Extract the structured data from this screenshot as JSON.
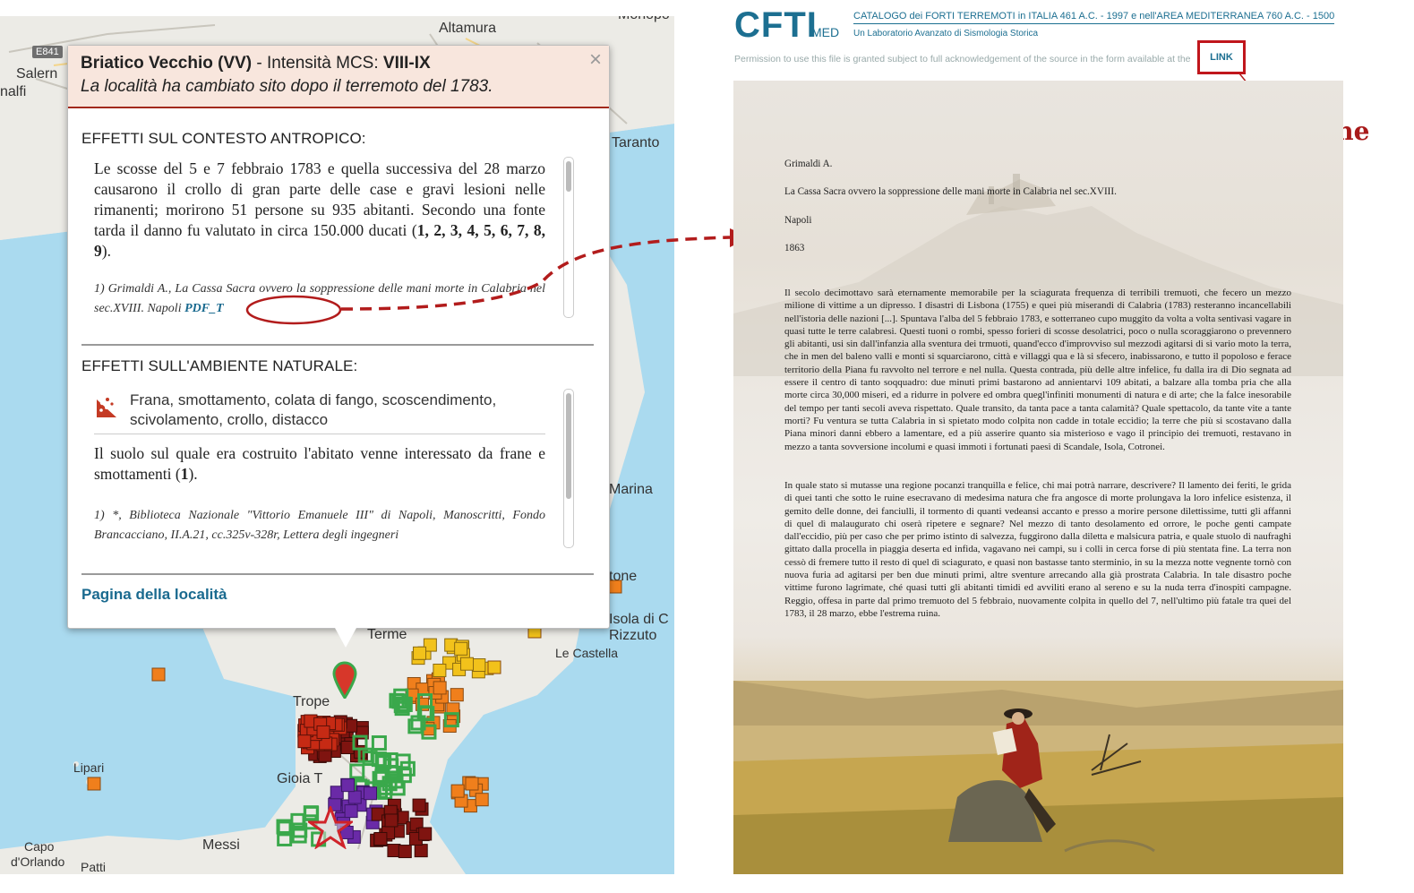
{
  "map": {
    "labels": {
      "altamura": "Altamura",
      "monopoli": "Monopo",
      "salerno": "Salern",
      "amalfi": "nalfi",
      "taranto": "Taranto",
      "marina": "Marina",
      "crotone": "tone",
      "isola1": "Isola di C",
      "isola2": "Rizzuto",
      "castella": "Le Castella",
      "terme": "Terme",
      "tropea": "Trope",
      "gioia": "Gioia T",
      "lipari": "Lipari",
      "capo1": "Capo",
      "capo2": "d'Orlando",
      "patti": "Patti",
      "messina": "Messi"
    },
    "road_badge": "E841",
    "colors": {
      "red": "#c62a14",
      "darkred": "#7f1410",
      "green": "#3aa84b",
      "orange": "#f07f1c",
      "yellow": "#f2c21b",
      "purple": "#6a2aa7"
    }
  },
  "popup": {
    "place": "Briatico Vecchio (VV)",
    "intensity_prefix": " - Intensità MCS: ",
    "intensity": "VIII-IX",
    "note": "La località ha cambiato sito dopo il terremoto del 1783.",
    "close": "×",
    "section1": {
      "title": "EFFETTI SUL CONTESTO ANTROPICO:",
      "text": "Le scosse del 5 e 7 febbraio 1783 e quella successiva del 28 marzo causarono il crollo di gran parte delle case e gravi lesioni nelle rimanenti; morirono 51 persone su 935 abitanti. Secondo una fonte tarda il danno fu valutato in circa 150.000 ducati (",
      "refs": "1, 2, 3, 4, 5, 6, 7, 8, 9",
      "tail": ").",
      "citation": "1) Grimaldi A., La Cassa Sacra ovvero la soppressione delle mani morte in Calabria nel sec.XVIII. Napoli",
      "pdf_link": "PDF_T"
    },
    "section2": {
      "title": "EFFETTI SULL'AMBIENTE NATURALE:",
      "effect": "Frana, smottamento, colata di fango, scoscendimento, scivolamento, crollo, distacco",
      "text": "Il suolo sul quale era costruito l'abitato venne interessato da frane e smottamenti (",
      "ref": "1",
      "tail": ").",
      "citation": "1) *, Biblioteca Nazionale \"Vittorio Emanuele III\" di Napoli, Manoscritti, Fondo Brancacciano, II.A.21, cc.325v-328r, Lettera degli ingegneri"
    },
    "place_link": "Pagina della località"
  },
  "document": {
    "logo": "CFTI",
    "logo_suffix": "MED",
    "catalog": "CATALOGO dei FORTI TERREMOTI in ITALIA 461 A.C. - 1997 e nell'AREA MEDITERRANEA 760 A.C. - 1500",
    "lab": "Un Laboratorio Avanzato di Sismologia Storica",
    "permission": "Permission to use this file is granted subject to full acknowledgement of the source in the form available at the",
    "link": "LINK",
    "annotation": "Citazione",
    "author": "Grimaldi A.",
    "title": "La Cassa Sacra ovvero la soppressione delle mani morte in Calabria nel sec.XVIII.",
    "city": "Napoli",
    "year": "1863",
    "paragraph1": "Il secolo decimottavo sarà eternamente memorabile per la sciagurata frequenza di terribili tremuoti, che fecero un mezzo milione di vittime a un dipresso. I disastri di Lisbona (1755) e quei più miserandi di Calabria (1783) resteranno incancellabili nell'istoria delle nazioni [...]. Spuntava l'alba del 5 febbraio 1783, e sotterraneo cupo muggito da volta a volta sentivasi vagare in quasi tutte le terre calabresi. Questi tuoni o rombi, spesso forieri di scosse desolatrici, poco o nulla scoraggiarono o prevennero gli abitanti, usi sin dall'infanzia alla sventura dei trmuoti, quand'ecco d'improvviso sul mezzodì agitarsi di sì vario moto la terra, che in men del baleno valli e monti si squarciarono, città e villaggi qua e là si sfecero, inabissarono, e tutto il popoloso e ferace territorio della Piana fu ravvolto nel terrore e nel nulla. Questa contrada, più delle altre infelice, fu dalla ira di Dio segnata ad essere il centro di tanto soqquadro: due minuti primi bastarono ad annientarvi 109 abitati, a balzare alla tomba pria che alla morte circa 30,000 miseri, ed a ridurre in polvere ed ombra quegl'infiniti monumenti di natura e di arte; che la falce inesorabile del tempo per tanti secoli aveva rispettato. Quale transito, da tanta pace a tanta calamità? Quale spettacolo, da tante vite a tante morti? Fu ventura se tutta Calabria in sì spietato modo colpita non cadde in totale eccidio; la terre che più si scostavano dalla Piana minori danni ebbero a lamentare, ed a più asserire quanto sia misterioso e vago il principio dei tremuoti, restavano in mezzo a tanta sovversione incolumi e quasi immoti i fortunati paesi di Scandale, Isola, Cotronei.",
    "paragraph2": "In quale stato si mutasse una regione pocanzi tranquilla e felice, chi mai potrà narrare, descrivere? Il lamento dei feriti, le grida di quei tanti che sotto le ruine esecravano di medesima natura che fra angosce di morte prolungava la loro infelice esistenza, il gemito delle donne, dei fanciulli, il tormento di quanti vedeansi accanto e presso a morire persone dilettissime, tutti gli affanni di quel dì malaugurato chi oserà ripetere e segnare? Nel mezzo di tanto desolamento ed orrore, le poche genti campate dall'eccidio, più per caso che per primo istinto di salvezza, fuggirono dalla diletta e malsicura patria, e quale stuolo di naufraghi gittato dalla procella in piaggia deserta ed infida, vagavano nei campi, su i colli in cerca forse di più stentata fine. La terra non cessò di fremere tutto il resto di quel dì sciagurato, e quasi non bastasse tanto sterminio, in su la mezza notte vegnente tornò con nuova furia ad agitarsi per ben due minuti primi, altre sventure arrecando alla già prostrata Calabria. In tale disastro poche vittime furono lagrimate, ché quasi tutti gli abitanti timidi ed avviliti erano al sereno e su la nuda terra d'inospiti campagne. Reggio, offesa in parte dal primo tremuoto del 5 febbraio, nuovamente colpita in quello del 7, nell'ultimo più fatale tra quei del 1783, il 28 marzo, ebbe l'estrema ruina."
  }
}
